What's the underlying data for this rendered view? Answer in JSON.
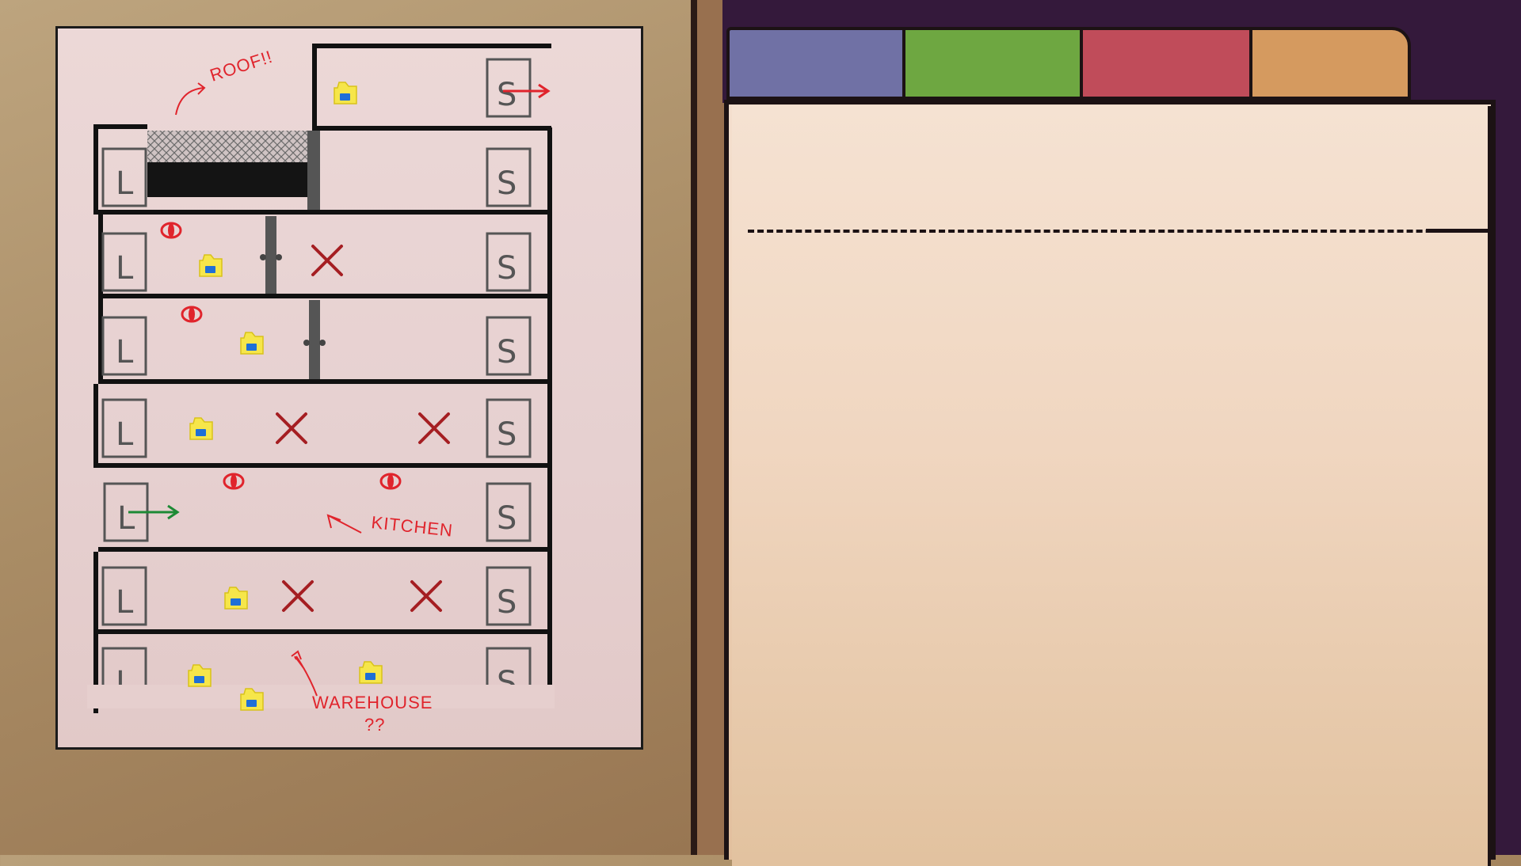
{
  "map": {
    "labels": {
      "roof": "ROOF!!",
      "kitchen": "KITCHEN",
      "warehouse": "WAREHOUSE",
      "warehouse_q": "??"
    },
    "room_marks": {
      "elevator": "L",
      "stairs": "S"
    },
    "colors": {
      "note_red": "#e0242c",
      "cross_red": "#a51e22",
      "exit_green": "#1d8a35",
      "folder_yellow": "#f6e64a",
      "folder_blue": "#1f6fd6"
    },
    "icons": [
      "folder-icon",
      "eye-icon",
      "cross-icon",
      "elevator-icon",
      "stairs-icon",
      "exit-arrow-icon"
    ]
  },
  "binder": {
    "tab_colors": [
      "#7071a5",
      "#6ea741",
      "#c04c5a",
      "#d59a5f"
    ],
    "folder_color": "#f2dcc8"
  }
}
